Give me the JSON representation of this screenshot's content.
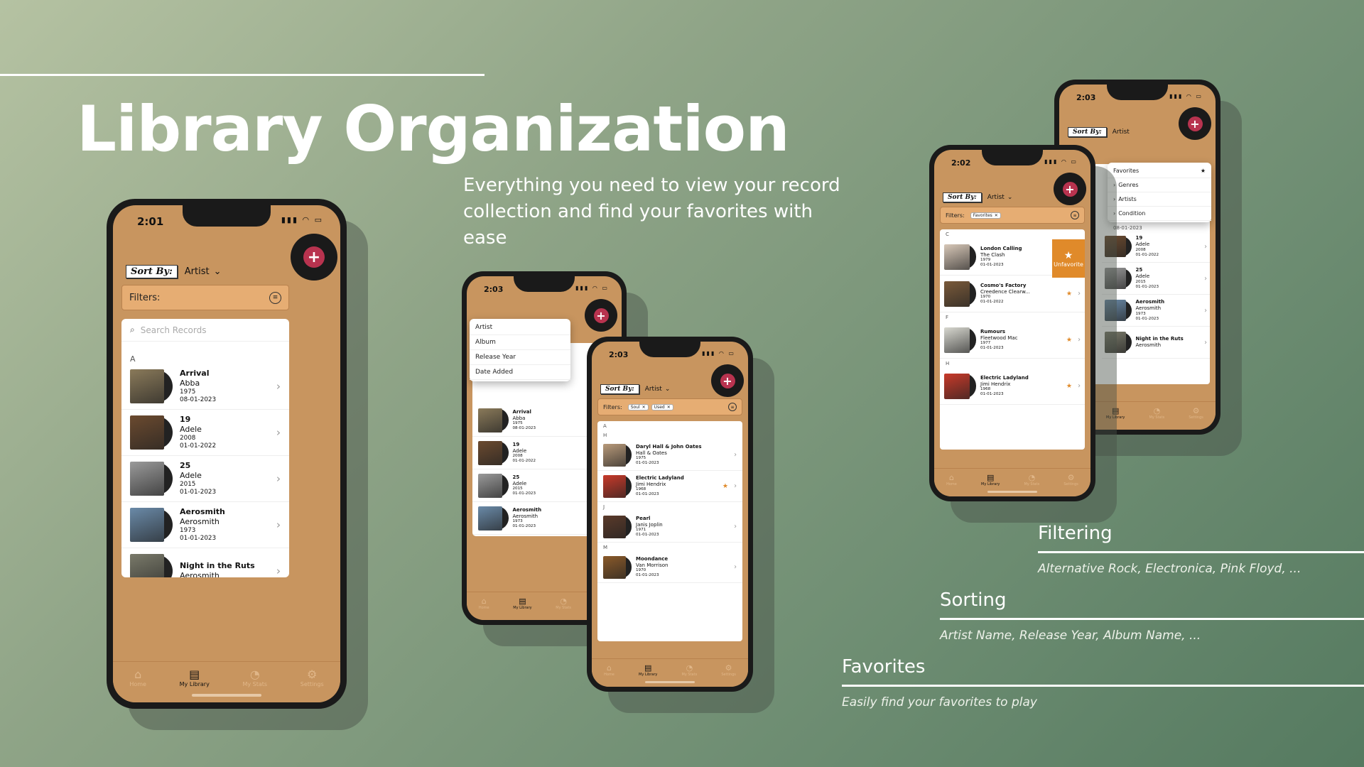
{
  "headline": "Library Organization",
  "subtitle": "Everything you need to view your record collection and find your favorites with ease",
  "features": [
    {
      "title": "Filtering",
      "desc": "Alternative Rock, Electronica, Pink Floyd, ..."
    },
    {
      "title": "Sorting",
      "desc": "Artist Name, Release Year, Album Name, ..."
    },
    {
      "title": "Favorites",
      "desc": "Easily find your favorites to play"
    }
  ],
  "common": {
    "sort_label": "Sort By:",
    "sort_value": "Artist",
    "filters_label": "Filters:",
    "search_placeholder": "Search Records",
    "add_symbol": "+",
    "chevron": "›",
    "caret": "⌄",
    "star": "★",
    "close": "✕",
    "sys": "▮▮▮ ◠ ▭"
  },
  "tabs": [
    {
      "label": "Home",
      "icon": "home-icon",
      "glyph": "⌂"
    },
    {
      "label": "My Library",
      "icon": "library-icon",
      "glyph": "▤"
    },
    {
      "label": "My Stats",
      "icon": "stats-icon",
      "glyph": "◔"
    },
    {
      "label": "Settings",
      "icon": "gear-icon",
      "glyph": "⚙"
    }
  ],
  "phone1": {
    "time": "2:01",
    "section": "A",
    "rows": [
      {
        "album": "Arrival",
        "artist": "Abba",
        "year": "1975",
        "date": "08-01-2023",
        "color": "#8a7a5a"
      },
      {
        "album": "19",
        "artist": "Adele",
        "year": "2008",
        "date": "01-01-2022",
        "color": "#6b4a2f"
      },
      {
        "album": "25",
        "artist": "Adele",
        "year": "2015",
        "date": "01-01-2023",
        "color": "#9a9a9a"
      },
      {
        "album": "Aerosmith",
        "artist": "Aerosmith",
        "year": "1973",
        "date": "01-01-2023",
        "color": "#6a8aa8"
      },
      {
        "album": "Night in the Ruts",
        "artist": "Aerosmith",
        "year": "",
        "date": "",
        "color": "#7a7a6a"
      }
    ]
  },
  "phone2": {
    "time": "2:03",
    "dropdown": [
      "Artist",
      "Album",
      "Release Year",
      "Date Added"
    ],
    "rows": [
      {
        "album": "Arrival",
        "artist": "Abba",
        "year": "1975",
        "date": "08-01-2023",
        "color": "#8a7a5a"
      },
      {
        "album": "19",
        "artist": "Adele",
        "year": "2008",
        "date": "01-01-2022",
        "color": "#6b4a2f"
      },
      {
        "album": "25",
        "artist": "Adele",
        "year": "2015",
        "date": "01-01-2023",
        "color": "#9a9a9a"
      },
      {
        "album": "Aerosmith",
        "artist": "Aerosmith",
        "year": "1973",
        "date": "01-01-2023",
        "color": "#6a8aa8"
      },
      {
        "album": "Night in the Ruts",
        "artist": "Aerosmith",
        "year": "",
        "date": "",
        "color": "#7a7a6a"
      }
    ]
  },
  "phone3": {
    "time": "2:03",
    "chips": [
      "Soul",
      "Used"
    ],
    "sections": [
      {
        "letter": "A",
        "rows": []
      },
      {
        "letter": "H",
        "rows": [
          {
            "album": "Daryl Hall & John Oates",
            "artist": "Hall & Oates",
            "year": "1975",
            "date": "01-01-2023",
            "color": "#b89a7a",
            "fav": false
          },
          {
            "album": "Electric Ladyland",
            "artist": "Jimi Hendrix",
            "year": "1968",
            "date": "01-01-2023",
            "color": "#c83a2a",
            "fav": true
          }
        ]
      },
      {
        "letter": "J",
        "rows": [
          {
            "album": "Pearl",
            "artist": "Janis Joplin",
            "year": "1971",
            "date": "01-01-2023",
            "color": "#5a3a2a",
            "fav": false
          }
        ]
      },
      {
        "letter": "M",
        "rows": [
          {
            "album": "Moondance",
            "artist": "Van Morrison",
            "year": "1970",
            "date": "01-01-2023",
            "color": "#8a5a2a",
            "fav": false
          }
        ]
      }
    ]
  },
  "phone4": {
    "time": "2:03",
    "filter_menu": [
      "Favorites",
      "Genres",
      "Artists",
      "Condition"
    ],
    "date_top": "08-01-2023",
    "rows": [
      {
        "album": "19",
        "artist": "Adele",
        "year": "2008",
        "date": "01-01-2022",
        "color": "#6b4a2f"
      },
      {
        "album": "25",
        "artist": "Adele",
        "year": "2015",
        "date": "01-01-2023",
        "color": "#9a9a9a"
      },
      {
        "album": "Aerosmith",
        "artist": "Aerosmith",
        "year": "1973",
        "date": "01-01-2023",
        "color": "#6a8aa8"
      },
      {
        "album": "Night in the Ruts",
        "artist": "Aerosmith",
        "year": "",
        "date": "",
        "color": "#7a7a6a"
      }
    ]
  },
  "phone5": {
    "time": "2:02",
    "chips": [
      "Favorites"
    ],
    "unfavorite": "Unfavorite",
    "sections": [
      {
        "letter": "C",
        "rows": [
          {
            "album": "London Calling",
            "artist": "The Clash",
            "year": "1979",
            "date": "01-01-2023",
            "color": "#d8c8b8"
          },
          {
            "album": "Cosmo's Factory",
            "artist": "Creedence Clearw...",
            "year": "1970",
            "date": "01-01-2022",
            "color": "#7a5a3a"
          }
        ]
      },
      {
        "letter": "F",
        "rows": [
          {
            "album": "Rumours",
            "artist": "Fleetwood Mac",
            "year": "1977",
            "date": "01-01-2023",
            "color": "#d8d8d0"
          }
        ]
      },
      {
        "letter": "H",
        "rows": [
          {
            "album": "Electric Ladyland",
            "artist": "Jimi Hendrix",
            "year": "1968",
            "date": "01-01-2023",
            "color": "#c83a2a"
          }
        ]
      }
    ]
  }
}
